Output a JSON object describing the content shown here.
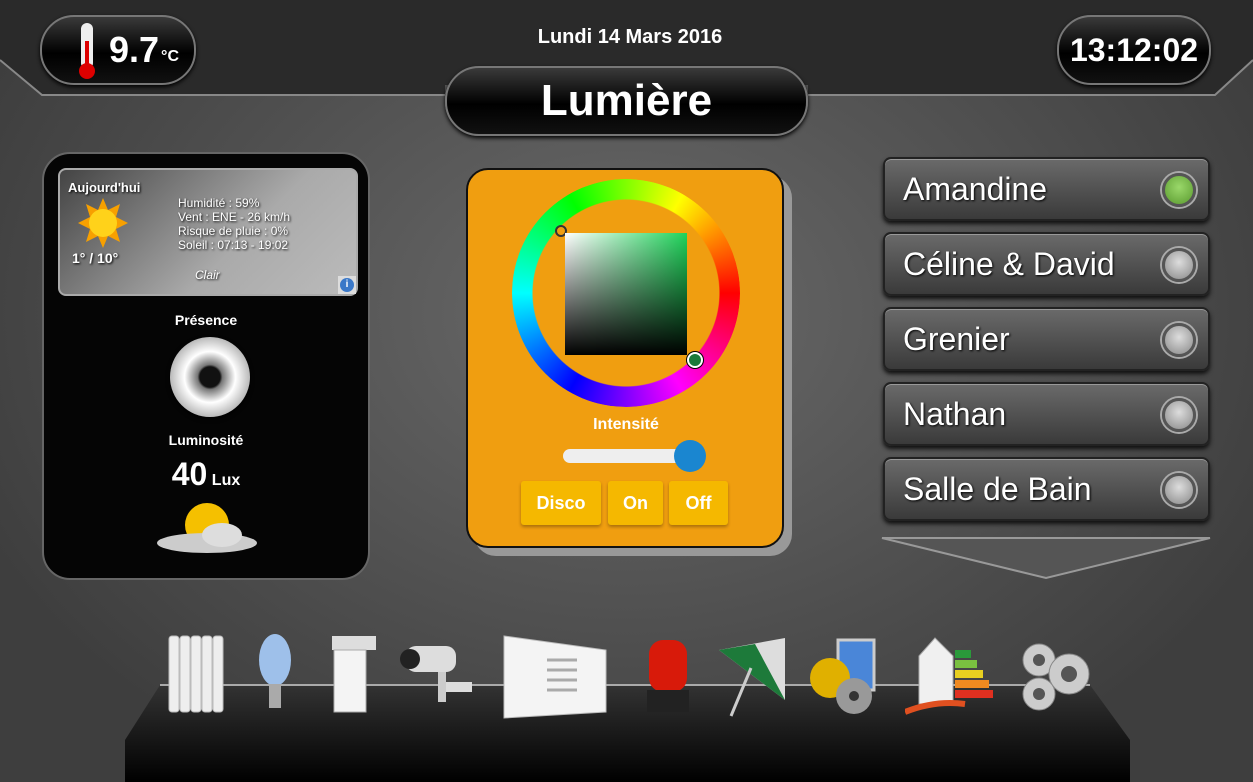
{
  "header": {
    "temperature": "9.7",
    "temperature_unit": "°C",
    "date": "Lundi 14 Mars 2016",
    "title": "Lumière",
    "time": "13:12:02"
  },
  "weather": {
    "label": "Aujourd'hui",
    "temps": "1° / 10°",
    "humidity": "Humidité : 59%",
    "wind": "Vent : ENE - 26 km/h",
    "rain": "Risque de pluie : 0%",
    "sun": "Soleil : 07:13 - 19:02",
    "condition": "Clair"
  },
  "sensors": {
    "presence_label": "Présence",
    "luminosity_label": "Luminosité",
    "luminosity_value": "40",
    "luminosity_unit": "Lux"
  },
  "light": {
    "intensity_label": "Intensité",
    "intensity_percent": 90,
    "buttons": [
      "Disco",
      "On",
      "Off"
    ],
    "selected_color": "#1fd35a"
  },
  "rooms": [
    {
      "name": "Amandine",
      "on": true
    },
    {
      "name": "Céline & David",
      "on": false
    },
    {
      "name": "Grenier",
      "on": false
    },
    {
      "name": "Nathan",
      "on": false
    },
    {
      "name": "Salle de Bain",
      "on": false
    }
  ],
  "dock": [
    "radiator-icon",
    "light-bulb-icon",
    "shutter-icon",
    "camera-icon",
    "gate-icon",
    "alarm-icon",
    "umbrella-icon",
    "multimedia-icon",
    "energy-icon",
    "settings-icon"
  ],
  "colors": {
    "accent": "#f09e10",
    "button": "#f5b800",
    "slider_knob": "#1a86d0",
    "led_on": "#6db33f"
  }
}
